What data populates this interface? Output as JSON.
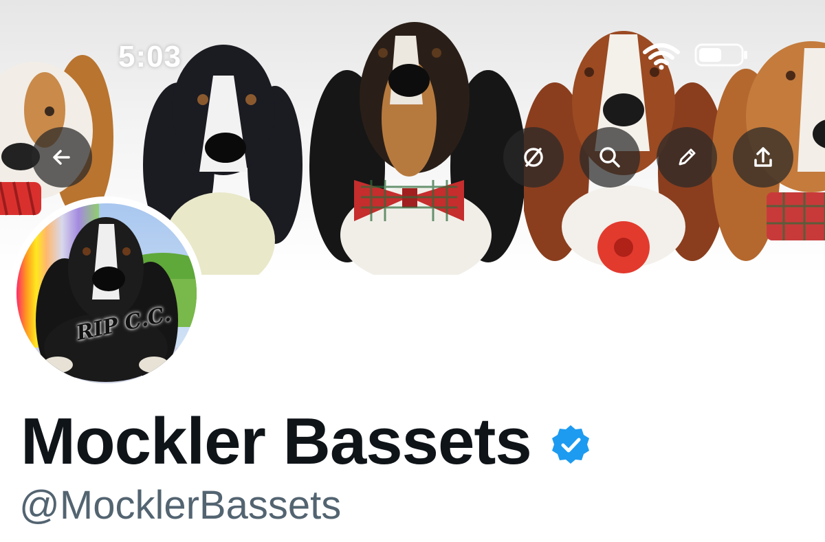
{
  "status_bar": {
    "time": "5:03"
  },
  "header_buttons": {
    "back": {
      "icon": "arrow-left-icon"
    },
    "grok": {
      "icon": "slashed-circle-icon"
    },
    "search": {
      "icon": "search-icon"
    },
    "edit": {
      "icon": "pencil-icon"
    },
    "share": {
      "icon": "share-upload-icon"
    }
  },
  "avatar": {
    "caption": "RIP C.C."
  },
  "profile": {
    "display_name": "Mockler Bassets",
    "handle": "@MocklerBassets",
    "verified_color": "#1d9bf0"
  }
}
